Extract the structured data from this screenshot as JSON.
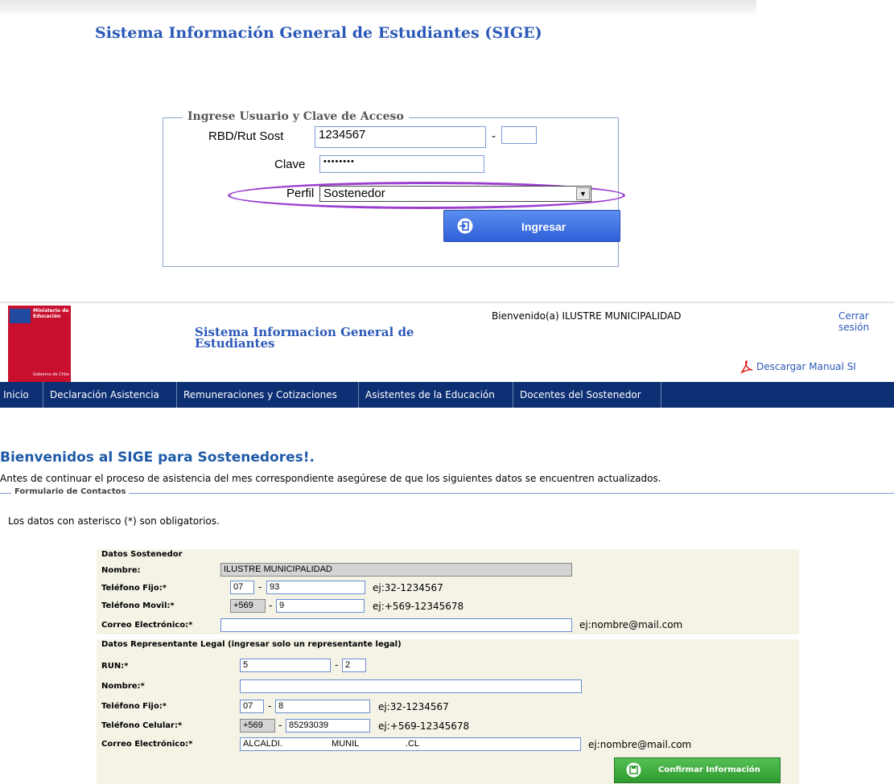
{
  "login": {
    "app_title": "Sistema Información General de Estudiantes (SIGE)",
    "legend": "Ingrese Usuario y Clave de Acceso",
    "rbd_label": "RBD/Rut Sost",
    "rbd_value": "1234567",
    "dash": "-",
    "dv_value": "",
    "clave_label": "Clave",
    "clave_value": "••••••••",
    "perfil_label": "Perfil",
    "perfil_value": "Sostenedor",
    "ingresar_label": "Ingresar",
    "highlight_color": "#9b3fcf"
  },
  "header": {
    "ministry_line1": "Ministerio de",
    "ministry_line2": "Educación",
    "gobierno": "Gobierno de Chile",
    "app_title": "Sistema Informacion General de Estudiantes",
    "welcome": "Bienvenido(a)  ILUSTRE MUNICIPALIDAD",
    "logout": "Cerrar sesión",
    "manual": "Descargar Manual SI"
  },
  "nav": {
    "items": [
      "Inicio",
      "Declaración Asistencia",
      "Remuneraciones y Cotizaciones",
      "Asistentes de la Educación",
      "Docentes del Sostenedor"
    ]
  },
  "main": {
    "heading": "Bienvenidos al SIGE para Sostenedores!.",
    "intro": "Antes de continuar el proceso de asistencia del mes correspondiente asegúrese de que los siguientes datos se encuentren actualizados.",
    "form_legend": "Formulario de Contactos",
    "required_note": "Los datos con asterisco (*) son obligatorios."
  },
  "sostenedor": {
    "section": "Datos Sostenedor",
    "nombre_label": "Nombre:",
    "nombre_value": "ILUSTRE MUNICIPALIDAD",
    "fijo_label": "Teléfono Fijo:*",
    "fijo_code": "07",
    "fijo_num": "93",
    "fijo_hint": "ej:32-1234567",
    "movil_label": "Teléfono Movil:*",
    "movil_code": "+569",
    "movil_num": "9",
    "movil_hint": "ej:+569-12345678",
    "correo_label": "Correo Electrónico:*",
    "correo_value": "",
    "correo_hint": "ej:nombre@mail.com"
  },
  "representante": {
    "section": "Datos Representante Legal (ingresar solo un representante legal)",
    "run_label": "RUN:*",
    "run_value": "5",
    "run_dv": "2",
    "nombre_label": "Nombre:*",
    "nombre_value": "",
    "fijo_label": "Teléfono Fijo:*",
    "fijo_code": "07",
    "fijo_num": "8",
    "fijo_hint": "ej:32-1234567",
    "celular_label": "Teléfono Celular:*",
    "celular_code": "+569",
    "celular_num": "85293039",
    "celular_hint": "ej:+569-12345678",
    "correo_label": "Correo Electrónico:*",
    "correo_value": "ALCALDI.                    MUNIL                   .CL",
    "correo_hint": "ej:nombre@mail.com",
    "confirm_label": "Confirmar Información"
  }
}
